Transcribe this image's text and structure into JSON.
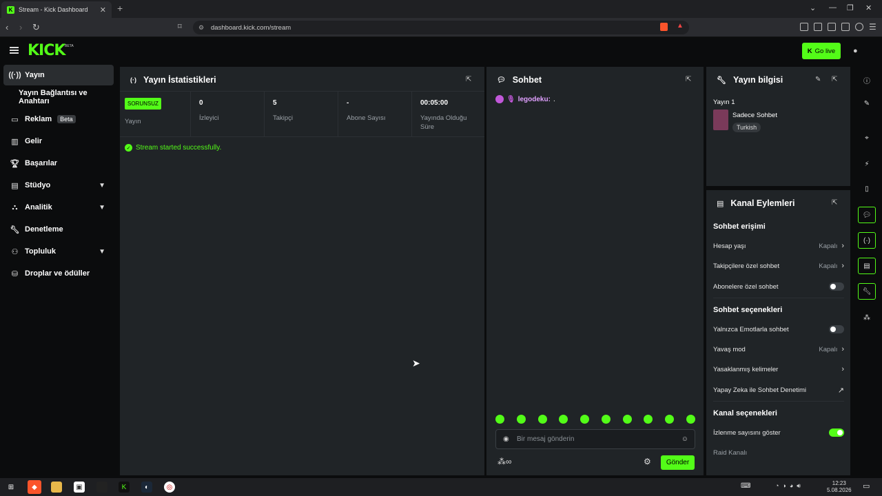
{
  "browser": {
    "tab_title": "Stream - Kick Dashboard",
    "new_tab": "+",
    "url": "dashboard.kick.com/stream"
  },
  "header": {
    "logo": "KICK",
    "logo_sup": "BETA",
    "go_live": "Go live"
  },
  "sidebar": {
    "items": [
      {
        "label": "Yayın",
        "icon": "stream-icon"
      },
      {
        "label": "Yayın Bağlantısı ve Anahtarı",
        "icon": ""
      },
      {
        "label": "Reklam",
        "icon": "ad-icon",
        "badge": "Beta"
      },
      {
        "label": "Gelir",
        "icon": "chart-icon"
      },
      {
        "label": "Başarılar",
        "icon": "trophy-icon"
      },
      {
        "label": "Stüdyo",
        "icon": "studio-icon"
      },
      {
        "label": "Analitik",
        "icon": "analytics-icon"
      },
      {
        "label": "Denetleme",
        "icon": "wrench-icon"
      },
      {
        "label": "Topluluk",
        "icon": "community-icon"
      },
      {
        "label": "Droplar ve ödüller",
        "icon": "drops-icon"
      }
    ]
  },
  "stats": {
    "title": "Yayın İstatistikleri",
    "status_badge": "SORUNSUZ",
    "status_label": "Yayın",
    "cells": [
      {
        "value": "0",
        "label": "İzleyici"
      },
      {
        "value": "5",
        "label": "Takipçi"
      },
      {
        "value": "-",
        "label": "Abone Sayısı"
      },
      {
        "value": "00:05:00",
        "label": "Yayında Olduğu Süre"
      }
    ],
    "success_message": "Stream started successfully."
  },
  "chat": {
    "title": "Sohbet",
    "message_user": "legodeku:",
    "message_text": ".",
    "input_placeholder": "Bir mesaj gönderin",
    "send_label": "Gönder"
  },
  "info": {
    "title": "Yayın bilgisi",
    "stream_name": "Yayın 1",
    "category": "Sadece Sohbet",
    "language": "Turkish"
  },
  "channel": {
    "title": "Kanal Eylemleri",
    "chat_access": "Sohbet erişimi",
    "account_age": {
      "label": "Hesap yaşı",
      "value": "Kapalı"
    },
    "followers_only": {
      "label": "Takipçilere özel sohbet",
      "value": "Kapalı"
    },
    "subs_only": {
      "label": "Abonelere özel sohbet"
    },
    "chat_options": "Sohbet seçenekleri",
    "emote_only": {
      "label": "Yalnızca Emotlarla sohbet"
    },
    "slow_mode": {
      "label": "Yavaş mod",
      "value": "Kapalı"
    },
    "banned_words": {
      "label": "Yasaklanmış kelimeler"
    },
    "ai_moderation": {
      "label": "Yapay Zeka ile Sohbet Denetimi"
    },
    "channel_options": "Kanal seçenekleri",
    "show_viewers": {
      "label": "İzlenme sayısını göster"
    },
    "raid_channel": {
      "label": "Raid Kanalı"
    }
  },
  "taskbar": {
    "time": "12:23",
    "date": "5.08.2026"
  },
  "colors": {
    "accent": "#53fc18",
    "panel": "#202427",
    "background": "#0b0c0d"
  }
}
